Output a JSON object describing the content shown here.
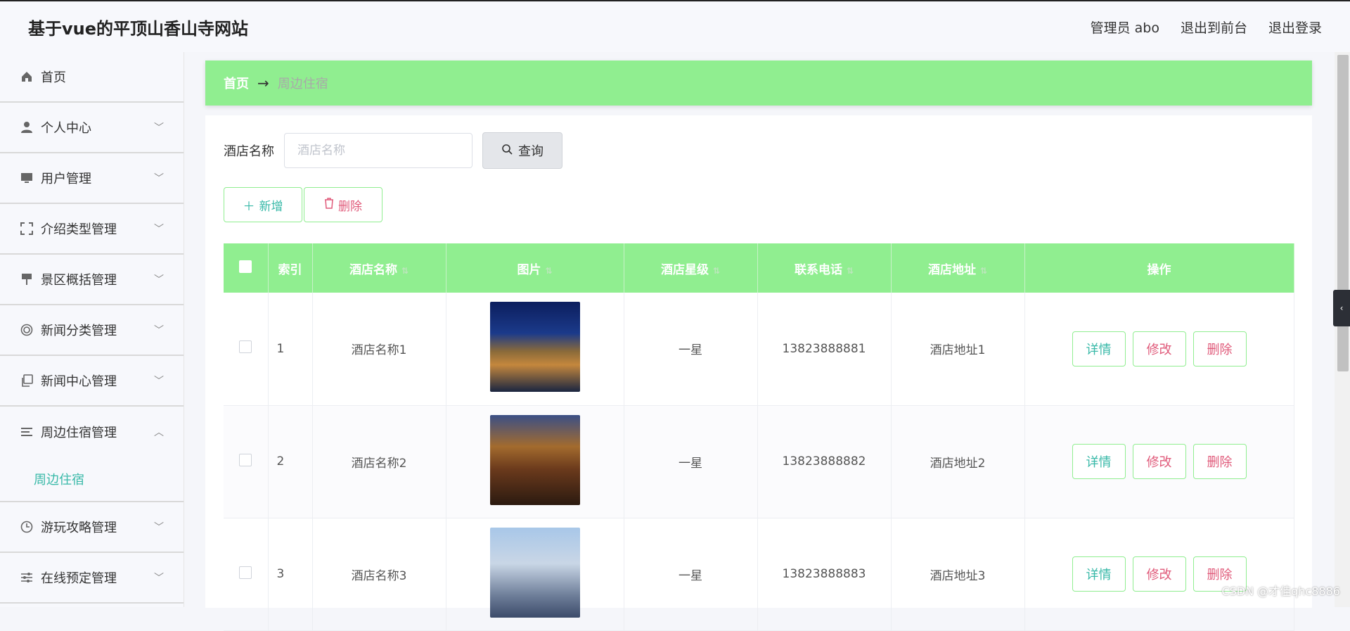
{
  "header": {
    "title": "基于vue的平顶山香山寺网站",
    "admin": "管理员 abo",
    "exit_front": "退出到前台",
    "logout": "退出登录"
  },
  "sidebar": {
    "items": [
      {
        "label": "首页",
        "icon": "home-icon"
      },
      {
        "label": "个人中心",
        "icon": "user-icon"
      },
      {
        "label": "用户管理",
        "icon": "monitor-icon"
      },
      {
        "label": "介绍类型管理",
        "icon": "fullscreen-icon"
      },
      {
        "label": "景区概括管理",
        "icon": "pin-icon"
      },
      {
        "label": "新闻分类管理",
        "icon": "target-icon"
      },
      {
        "label": "新闻中心管理",
        "icon": "copy-icon"
      },
      {
        "label": "周边住宿管理",
        "icon": "list-icon",
        "expanded": true
      },
      {
        "label": "游玩攻略管理",
        "icon": "clock-icon"
      },
      {
        "label": "在线预定管理",
        "icon": "sliders-icon"
      }
    ],
    "active_sub": "周边住宿"
  },
  "breadcrumb": {
    "home": "首页",
    "arrow": "→",
    "current": "周边住宿"
  },
  "search": {
    "label": "酒店名称",
    "placeholder": "酒店名称",
    "button": "查询"
  },
  "actions": {
    "add": "新增",
    "delete": "删除"
  },
  "table": {
    "columns": [
      "索引",
      "酒店名称",
      "图片",
      "酒店星级",
      "联系电话",
      "酒店地址",
      "操作"
    ],
    "rows": [
      {
        "index": "1",
        "name": "酒店名称1",
        "stars": "一星",
        "phone": "13823888881",
        "address": "酒店地址1"
      },
      {
        "index": "2",
        "name": "酒店名称2",
        "stars": "一星",
        "phone": "13823888882",
        "address": "酒店地址2"
      },
      {
        "index": "3",
        "name": "酒店名称3",
        "stars": "一星",
        "phone": "13823888883",
        "address": "酒店地址3"
      }
    ],
    "op_labels": {
      "detail": "详情",
      "edit": "修改",
      "delete": "删除"
    }
  },
  "watermark": "CSDN @才佳qhc8886",
  "colors": {
    "accent_green": "#90ee90",
    "teal_text": "#38b9a8",
    "pink_text": "#e05a7a"
  }
}
